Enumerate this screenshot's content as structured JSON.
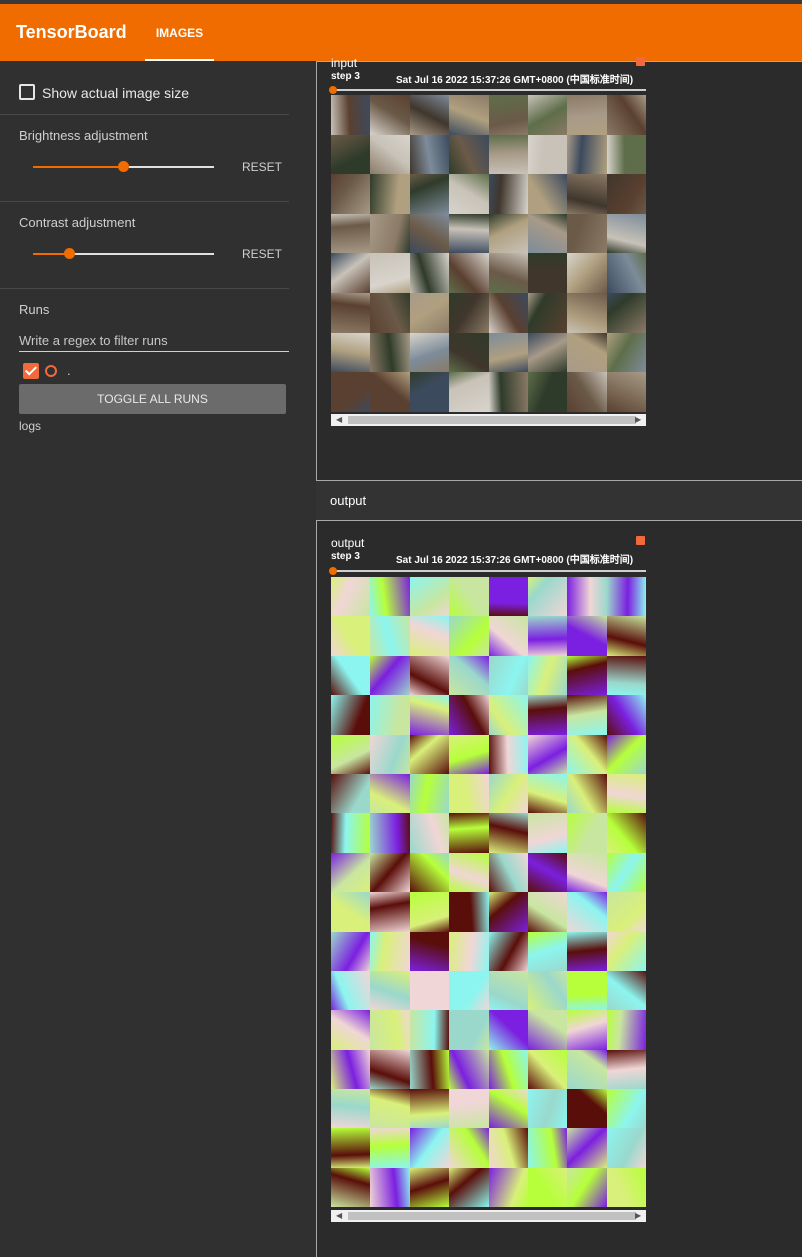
{
  "app": {
    "title": "TensorBoard",
    "tab": "IMAGES"
  },
  "sidebar": {
    "show_actual_size": "Show actual image size",
    "brightness": {
      "label": "Brightness adjustment",
      "reset": "RESET",
      "value": 0.5
    },
    "contrast": {
      "label": "Contrast adjustment",
      "reset": "RESET",
      "value": 0.2
    },
    "runs": {
      "label": "Runs",
      "filter_placeholder": "Write a regex to filter runs",
      "run_name": ".",
      "toggle_all": "TOGGLE ALL RUNS",
      "logdir": "logs"
    }
  },
  "cards": {
    "input": {
      "title": "input",
      "step": "step 3",
      "date": "Sat Jul 16 2022 15:37:26 GMT+0800 (中国标准时间)"
    },
    "output_section": "output",
    "output": {
      "title": "output",
      "step": "step 3",
      "date": "Sat Jul 16 2022 15:37:26 GMT+0800 (中国标准时间)"
    }
  },
  "colors": {
    "accent": "#f06c00",
    "run": "#f26a3b"
  }
}
